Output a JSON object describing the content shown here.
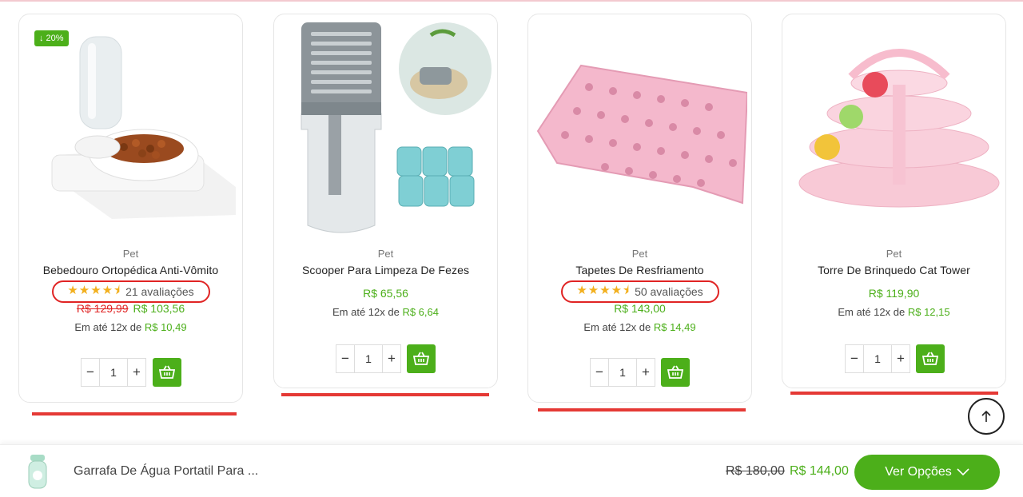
{
  "products": [
    {
      "badge": "↓ 20%",
      "category": "Pet",
      "name": "Bebedouro Ortopédica Anti-Vômito",
      "stars": "★★★★⯨",
      "reviews": "21 avaliações",
      "old_price": "R$ 129,99",
      "price": "R$ 103,56",
      "installment_prefix": "Em até 12x de",
      "installment_value": "R$ 10,49",
      "qty": "1"
    },
    {
      "category": "Pet",
      "name": "Scooper Para Limpeza De Fezes",
      "price": "R$ 65,56",
      "installment_prefix": "Em até 12x de",
      "installment_value": "R$ 6,64",
      "qty": "1"
    },
    {
      "category": "Pet",
      "name": "Tapetes De Resfriamento",
      "stars": "★★★★⯨",
      "reviews": "50 avaliações",
      "price": "R$ 143,00",
      "installment_prefix": "Em até 12x de",
      "installment_value": "R$ 14,49",
      "qty": "1"
    },
    {
      "category": "Pet",
      "name": "Torre De Brinquedo Cat Tower",
      "price": "R$ 119,90",
      "installment_prefix": "Em até 12x de",
      "installment_value": "R$ 12,15",
      "qty": "1"
    }
  ],
  "qty_controls": {
    "minus": "−",
    "plus": "+"
  },
  "sticky_bar": {
    "title": "Garrafa De Água Portatil Para ...",
    "old_price": "R$ 180,00",
    "price": "R$ 144,00",
    "button_label": "Ver Opções",
    "button_icon": "chevron-down-icon"
  },
  "icons": [
    "cart-basket-icon",
    "arrow-up-icon",
    "chevron-down-icon"
  ],
  "colors": {
    "accent_green": "#4caf1a",
    "highlight_red": "#e53935",
    "star_yellow": "#f2b01e"
  }
}
